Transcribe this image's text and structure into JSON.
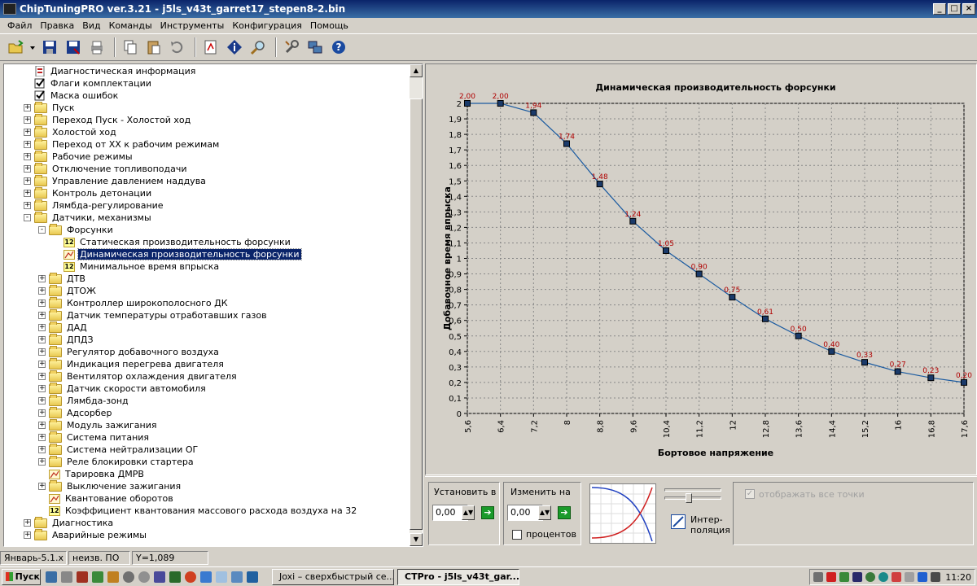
{
  "window": {
    "title": "ChipTuningPRO ver.3.21 - j5ls_v43t_garret17_stepen8-2.bin",
    "min": "_",
    "max": "□",
    "close": "×"
  },
  "menu": [
    "Файл",
    "Правка",
    "Вид",
    "Команды",
    "Инструменты",
    "Конфигурация",
    "Помощь"
  ],
  "toolbar_icons": [
    "open-icon",
    "dropdown-arrow-icon",
    "save-icon",
    "save-as-icon",
    "print-icon",
    "copy-icon",
    "paste-icon",
    "undo-icon",
    "compare-icon",
    "info-icon",
    "search-icon",
    "tools-icon",
    "network-icon",
    "help-icon"
  ],
  "tree": [
    {
      "label": "Диагностическая информация",
      "level": 0,
      "icon": "doc",
      "exp": ""
    },
    {
      "label": "Флаги комплектации",
      "level": 0,
      "icon": "check",
      "exp": ""
    },
    {
      "label": "Маска ошибок",
      "level": 0,
      "icon": "check",
      "exp": ""
    },
    {
      "label": "Пуск",
      "level": 0,
      "icon": "folder",
      "exp": "+"
    },
    {
      "label": "Переход Пуск - Холостой ход",
      "level": 0,
      "icon": "folder",
      "exp": "+"
    },
    {
      "label": "Холостой ход",
      "level": 0,
      "icon": "folder",
      "exp": "+"
    },
    {
      "label": "Переход от ХХ к рабочим режимам",
      "level": 0,
      "icon": "folder",
      "exp": "+"
    },
    {
      "label": "Рабочие режимы",
      "level": 0,
      "icon": "folder",
      "exp": "+"
    },
    {
      "label": "Отключение топливоподачи",
      "level": 0,
      "icon": "folder",
      "exp": "+"
    },
    {
      "label": "Управление давлением наддува",
      "level": 0,
      "icon": "folder",
      "exp": "+"
    },
    {
      "label": "Контроль детонации",
      "level": 0,
      "icon": "folder",
      "exp": "+"
    },
    {
      "label": "Лямбда-регулирование",
      "level": 0,
      "icon": "folder",
      "exp": "+"
    },
    {
      "label": "Датчики, механизмы",
      "level": 0,
      "icon": "folder",
      "exp": "−"
    },
    {
      "label": "Форсунки",
      "level": 1,
      "icon": "folder",
      "exp": "−"
    },
    {
      "label": "Статическая производительность форсунки",
      "level": 2,
      "icon": "12",
      "exp": ""
    },
    {
      "label": "Динамическая производительность форсунки",
      "level": 2,
      "icon": "chart",
      "exp": "",
      "selected": true
    },
    {
      "label": "Минимальное время впрыска",
      "level": 2,
      "icon": "12",
      "exp": ""
    },
    {
      "label": "ДТВ",
      "level": 1,
      "icon": "folder",
      "exp": "+"
    },
    {
      "label": "ДТОЖ",
      "level": 1,
      "icon": "folder",
      "exp": "+"
    },
    {
      "label": "Контроллер широкополосного ДК",
      "level": 1,
      "icon": "folder",
      "exp": "+"
    },
    {
      "label": "Датчик температуры отработавших газов",
      "level": 1,
      "icon": "folder",
      "exp": "+"
    },
    {
      "label": "ДАД",
      "level": 1,
      "icon": "folder",
      "exp": "+"
    },
    {
      "label": "ДПДЗ",
      "level": 1,
      "icon": "folder",
      "exp": "+"
    },
    {
      "label": "Регулятор добавочного воздуха",
      "level": 1,
      "icon": "folder",
      "exp": "+"
    },
    {
      "label": "Индикация перегрева двигателя",
      "level": 1,
      "icon": "folder",
      "exp": "+"
    },
    {
      "label": "Вентилятор охлаждения двигателя",
      "level": 1,
      "icon": "folder",
      "exp": "+"
    },
    {
      "label": "Датчик скорости автомобиля",
      "level": 1,
      "icon": "folder",
      "exp": "+"
    },
    {
      "label": "Лямбда-зонд",
      "level": 1,
      "icon": "folder",
      "exp": "+"
    },
    {
      "label": "Адсорбер",
      "level": 1,
      "icon": "folder",
      "exp": "+"
    },
    {
      "label": "Модуль зажигания",
      "level": 1,
      "icon": "folder",
      "exp": "+"
    },
    {
      "label": "Система питания",
      "level": 1,
      "icon": "folder",
      "exp": "+"
    },
    {
      "label": "Система нейтрализации ОГ",
      "level": 1,
      "icon": "folder",
      "exp": "+"
    },
    {
      "label": "Реле блокировки стартера",
      "level": 1,
      "icon": "folder",
      "exp": "+"
    },
    {
      "label": "Тарировка ДМРВ",
      "level": 1,
      "icon": "chart",
      "exp": ""
    },
    {
      "label": "Выключение зажигания",
      "level": 1,
      "icon": "folder",
      "exp": "+"
    },
    {
      "label": "Квантование оборотов",
      "level": 1,
      "icon": "chart",
      "exp": ""
    },
    {
      "label": "Коэффициент квантования массового расхода воздуха на 32",
      "level": 1,
      "icon": "12",
      "exp": ""
    },
    {
      "label": "Диагностика",
      "level": 0,
      "icon": "folder",
      "exp": "+"
    },
    {
      "label": "Аварийные режимы",
      "level": 0,
      "icon": "folder",
      "exp": "+"
    }
  ],
  "chart_data": {
    "type": "line",
    "title": "Динамическая производительность форсунки",
    "xlabel": "Бортовое напряжение",
    "ylabel": "Добавочное время впрыска",
    "x": [
      5.6,
      6.4,
      7.2,
      8,
      8.8,
      9.6,
      10.4,
      11.2,
      12,
      12.8,
      13.6,
      14.4,
      15.2,
      16,
      16.8,
      17.6
    ],
    "x_ticks": [
      "5,6",
      "6,4",
      "7,2",
      "8",
      "8,8",
      "9,6",
      "10,4",
      "11,2",
      "12",
      "12,8",
      "13,6",
      "14,4",
      "15,2",
      "16",
      "16,8",
      "17,6"
    ],
    "values": [
      2.0,
      2.0,
      1.94,
      1.74,
      1.48,
      1.24,
      1.05,
      0.9,
      0.75,
      0.61,
      0.5,
      0.4,
      0.33,
      0.27,
      0.23,
      0.2
    ],
    "value_labels": [
      "2,00",
      "2,00",
      "1,94",
      "1,74",
      "1,48",
      "1,24",
      "1,05",
      "0,90",
      "0,75",
      "0,61",
      "0,50",
      "0,40",
      "0,33",
      "0,27",
      "0,23",
      "0,20"
    ],
    "y_ticks": [
      "0",
      "0,1",
      "0,2",
      "0,3",
      "0,4",
      "0,5",
      "0,6",
      "0,7",
      "0,8",
      "0,9",
      "1",
      "1,1",
      "1,2",
      "1,3",
      "1,4",
      "1,5",
      "1,6",
      "1,7",
      "1,8",
      "1,9",
      "2"
    ],
    "ylim": [
      0,
      2
    ],
    "grid": true,
    "line_color": "#1a5aa0",
    "label_color": "#b00000"
  },
  "controls": {
    "set_label": "Установить в",
    "set_value": "0,00",
    "change_label": "Изменить на",
    "change_value": "0,00",
    "percent_label": "процентов",
    "interp_label1": "Интер-",
    "interp_label2": "поляция",
    "show_all_label": "отображать все точки"
  },
  "status": {
    "version": "Январь-5.1.х",
    "fw": "неизв. ПО",
    "y": "Y=1,089"
  },
  "taskbar": {
    "start": "Пуск",
    "task1": "Joxi – сверхбыстрый се...",
    "task2": "CTPro - j5ls_v43t_gar...",
    "clock": "11:20"
  }
}
